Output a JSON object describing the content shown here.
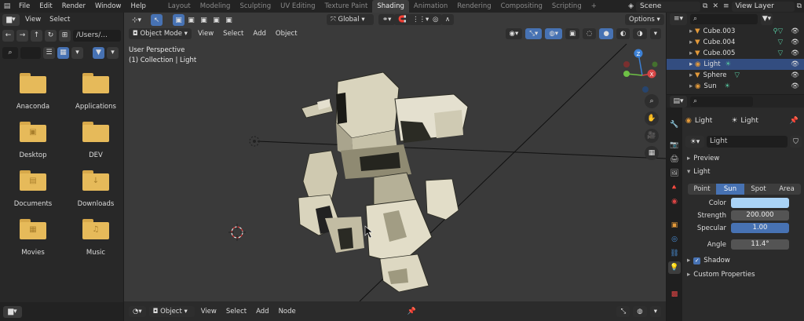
{
  "topbar": {
    "menus": [
      "File",
      "Edit",
      "Render",
      "Window",
      "Help"
    ],
    "workspaces": [
      "Layout",
      "Modeling",
      "Sculpting",
      "UV Editing",
      "Texture Paint",
      "Shading",
      "Animation",
      "Rendering",
      "Compositing",
      "Scripting"
    ],
    "active_workspace": "Shading",
    "add_tab": "+",
    "scene": "Scene",
    "view_layer": "View Layer"
  },
  "file_browser": {
    "menus": [
      "View",
      "Select"
    ],
    "path": "/Users/...",
    "folders": [
      {
        "label": "Anaconda",
        "icon": "folder-icon",
        "glyph": ""
      },
      {
        "label": "Applications",
        "icon": "folder-icon",
        "glyph": ""
      },
      {
        "label": "Desktop",
        "icon": "folder-desktop-icon",
        "glyph": "▣"
      },
      {
        "label": "DEV",
        "icon": "folder-icon",
        "glyph": ""
      },
      {
        "label": "Documents",
        "icon": "folder-documents-icon",
        "glyph": "▤"
      },
      {
        "label": "Downloads",
        "icon": "folder-downloads-icon",
        "glyph": "↓"
      },
      {
        "label": "Movies",
        "icon": "folder-movies-icon",
        "glyph": "▦"
      },
      {
        "label": "Music",
        "icon": "folder-music-icon",
        "glyph": "♫"
      }
    ]
  },
  "viewport": {
    "mode": "Object Mode",
    "menus": [
      "View",
      "Select",
      "Add",
      "Object"
    ],
    "transform_orientation": "Global",
    "options_label": "Options",
    "perspective_label": "User Perspective",
    "collection_label": "(1) Collection | Light",
    "gizmo_axes": [
      "X",
      "Y",
      "Z"
    ]
  },
  "bottom_editor": {
    "object_selector": "Object",
    "menus": [
      "View",
      "Select",
      "Add",
      "Node"
    ]
  },
  "outliner": {
    "rows": [
      {
        "name": "Cube.003",
        "selected": false
      },
      {
        "name": "Cube.004",
        "selected": false
      },
      {
        "name": "Cube.005",
        "selected": false
      },
      {
        "name": "Light",
        "selected": true
      },
      {
        "name": "Sphere",
        "selected": false
      },
      {
        "name": "Sun",
        "selected": false
      }
    ]
  },
  "properties": {
    "object_name": "Light",
    "data_name": "Light",
    "datablock_name": "Light",
    "preview_label": "Preview",
    "light_label": "Light",
    "light_types": [
      "Point",
      "Sun",
      "Spot",
      "Area"
    ],
    "active_light_type": "Sun",
    "color_label": "Color",
    "color_value": "#a9d3f6",
    "strength_label": "Strength",
    "strength_value": "200.000",
    "specular_label": "Specular",
    "specular_value": "1.00",
    "angle_label": "Angle",
    "angle_value": "11.4°",
    "shadow_label": "Shadow",
    "shadow_checked": true,
    "custom_props_label": "Custom Properties"
  },
  "colors": {
    "accent_blue": "#4772b3",
    "selection_row": "#334d80",
    "folder_yellow": "#e6ba5a",
    "viewport_bg": "#3a3a3a",
    "light_icon_orange": "#e49a3a",
    "mesh_icon_green": "#57c7a0"
  }
}
